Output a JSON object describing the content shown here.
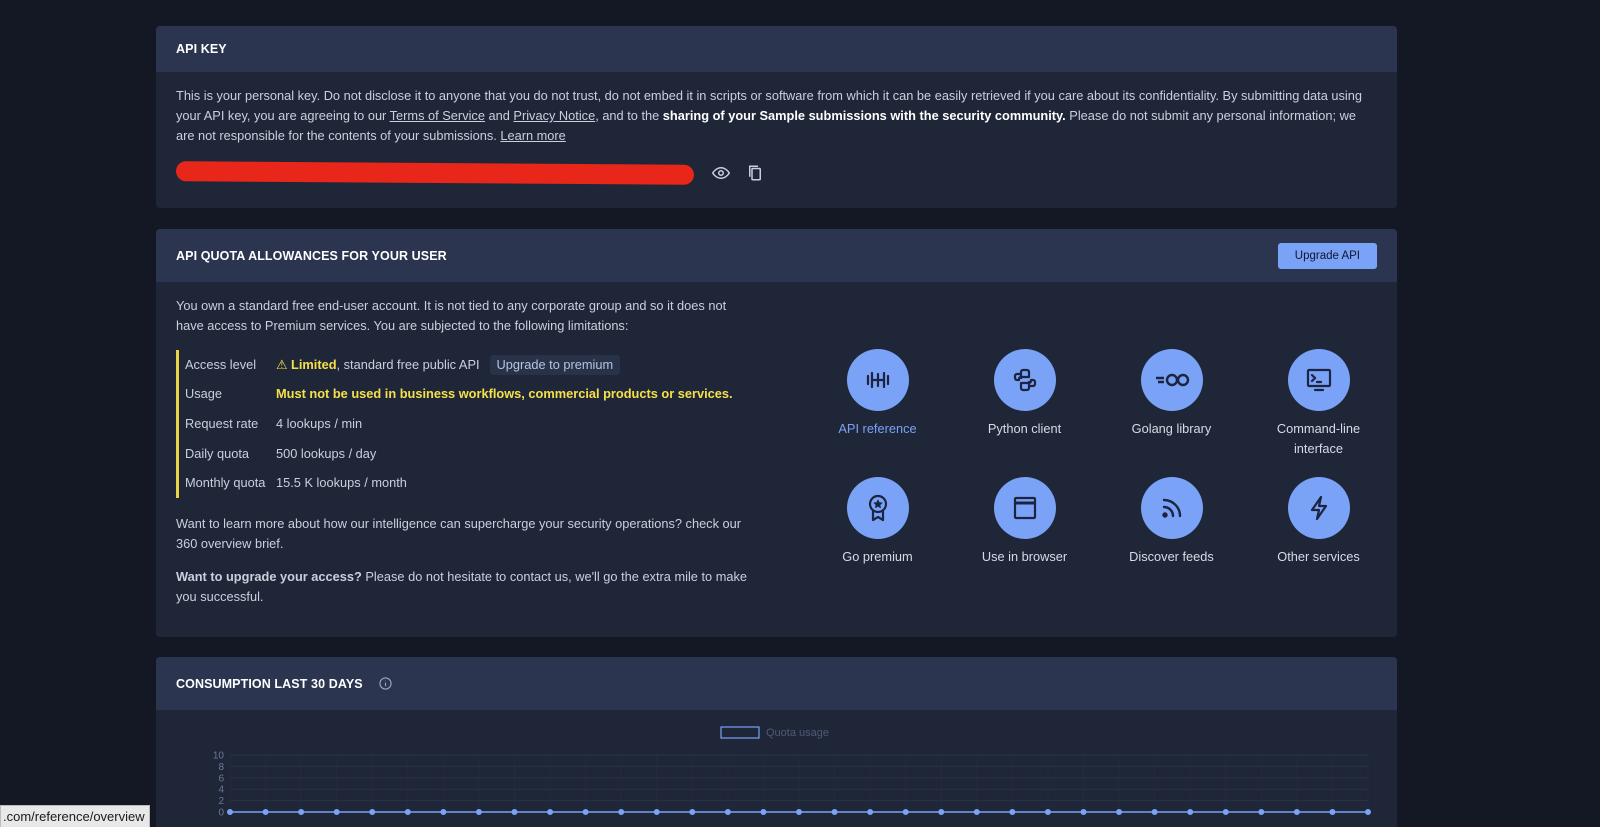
{
  "api_key": {
    "header": "API KEY",
    "intro_1": "This is your personal key. Do not disclose it to anyone that you do not trust, do not embed it in scripts or software from which it can be easily retrieved if you care about its confidentiality. By submitting data using your API key, you are agreeing to our ",
    "terms_link": "Terms of Service",
    "and_text": " and ",
    "privacy_link": "Privacy Notice",
    "intro_2": ", and to the ",
    "intro_bold": "sharing of your Sample submissions with the security community.",
    "intro_3": " Please do not submit any personal information; we are not responsible for the contents of your submissions. ",
    "learn_more": "Learn more",
    "show_icon": "eye-icon",
    "copy_icon": "copy-icon"
  },
  "quota": {
    "header": "API QUOTA ALLOWANCES FOR YOUR USER",
    "upgrade_button": "Upgrade API",
    "intro": "You own a standard free end-user account. It is not tied to any corporate group and so it does not have access to Premium services. You are subjected to the following limitations:",
    "limits": [
      {
        "label": "Access level",
        "prefix": "⚠ ",
        "highlight": "Limited",
        "rest": ", standard free public API",
        "pill": "Upgrade to premium"
      },
      {
        "label": "Usage",
        "value": "Must not be used in business workflows, commercial products or services."
      },
      {
        "label": "Request rate",
        "value": "4 lookups / min"
      },
      {
        "label": "Daily quota",
        "value": "500 lookups / day"
      },
      {
        "label": "Monthly quota",
        "value": "15.5 K lookups / month"
      }
    ],
    "learn_more_text": "Want to learn more about how our intelligence can supercharge your security operations? check our 360 overview brief.",
    "upgrade_bold": "Want to upgrade your access?",
    "upgrade_text": " Please do not hesitate to contact us, we'll go the extra mile to make you successful.",
    "tiles": [
      {
        "label": "API reference",
        "icon": "api-icon"
      },
      {
        "label": "Python client",
        "icon": "python-icon"
      },
      {
        "label": "Golang library",
        "icon": "go-icon"
      },
      {
        "label": "Command-line interface",
        "icon": "terminal-icon"
      },
      {
        "label": "Go premium",
        "icon": "award-icon"
      },
      {
        "label": "Use in browser",
        "icon": "browser-icon"
      },
      {
        "label": "Discover feeds",
        "icon": "rss-icon"
      },
      {
        "label": "Other services",
        "icon": "lightning-icon"
      }
    ]
  },
  "consumption": {
    "header": "CONSUMPTION LAST 30 DAYS",
    "info_icon": "info-icon"
  },
  "chart_data": {
    "type": "line",
    "title": "",
    "xlabel": "",
    "ylabel": "",
    "series": [
      {
        "name": "Quota usage",
        "values": [
          0,
          0,
          0,
          0,
          0,
          0,
          0,
          0,
          0,
          0,
          0,
          0,
          0,
          0,
          0,
          0,
          0,
          0,
          0,
          0,
          0,
          0,
          0,
          0,
          0,
          0,
          0,
          0,
          0,
          0,
          0,
          0,
          0
        ]
      }
    ],
    "yticks": [
      "10",
      "8",
      "6",
      "4",
      "2",
      "0"
    ],
    "ylim": [
      0,
      10
    ],
    "color": "#7aa2f7",
    "legend": "top-center"
  },
  "status_bar": {
    "url": ".com/reference/overview"
  }
}
